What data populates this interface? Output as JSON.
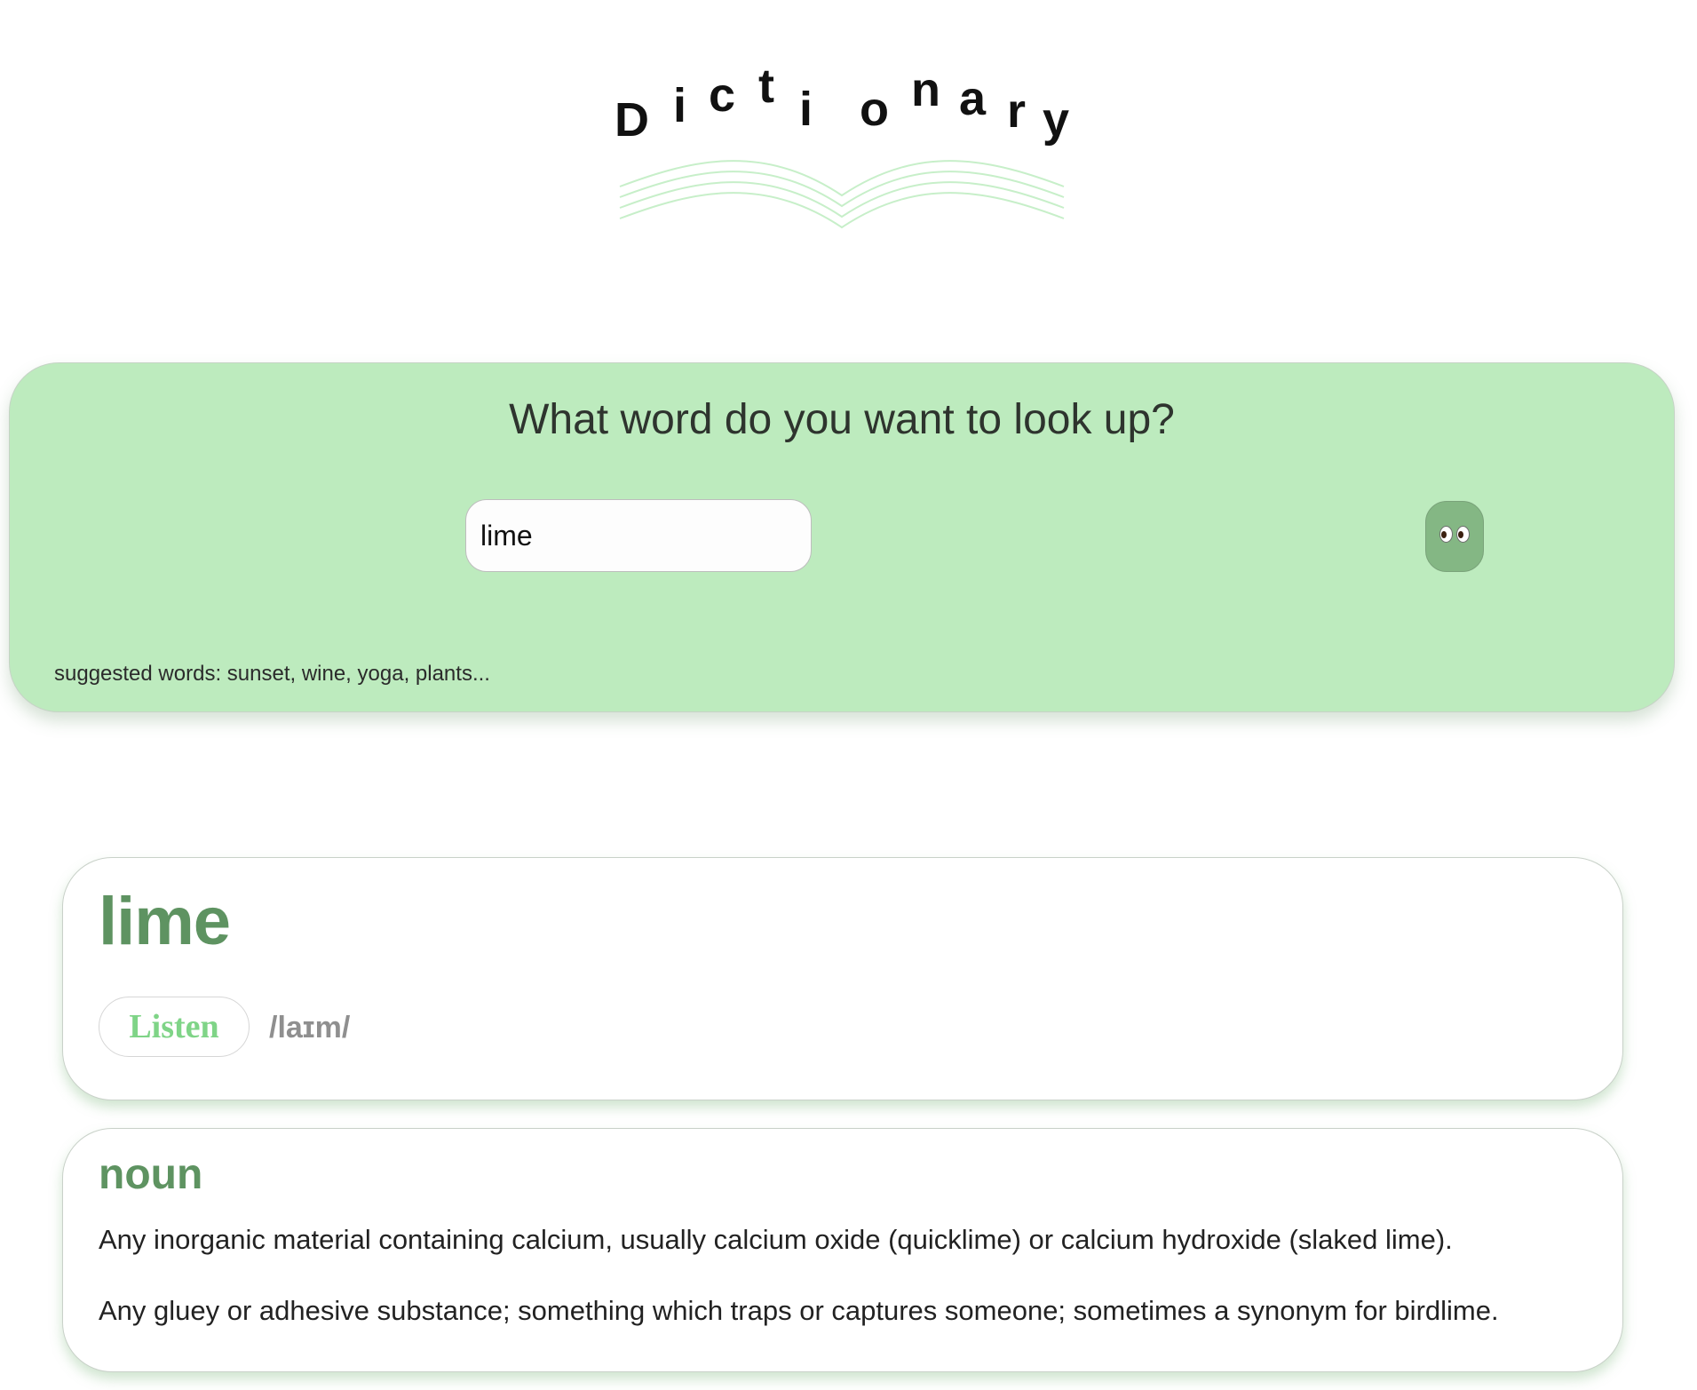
{
  "logo": {
    "letters": [
      "D",
      "i",
      "c",
      "t",
      "i",
      "o",
      "n",
      "a",
      "r",
      "y"
    ],
    "book_color": "#c7efc9"
  },
  "search": {
    "heading": "What word do you want to look up?",
    "input_value": "lime",
    "button_icon": "eyes-icon",
    "suggested": "suggested words: sunset, wine, yoga, plants..."
  },
  "result": {
    "word": "lime",
    "listen_label": "Listen",
    "phonetic": "/laɪm/",
    "part_of_speech": "noun",
    "definitions": [
      "Any inorganic material containing calcium, usually calcium oxide (quicklime) or calcium hydroxide (slaked lime).",
      "Any gluey or adhesive substance; something which traps or captures someone; sometimes a synonym for birdlime."
    ]
  },
  "colors": {
    "panel": "#bdebbe",
    "accent": "#5e9361",
    "listen": "#7fd487",
    "button": "#84b784"
  }
}
